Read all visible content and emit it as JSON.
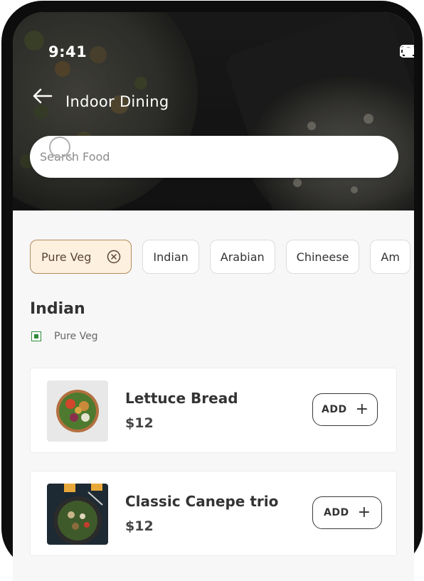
{
  "status_bar": {
    "time": "9:41"
  },
  "header": {
    "title": "Indoor Dining"
  },
  "search": {
    "placeholder": "Search Food",
    "value": ""
  },
  "filters": [
    {
      "label": "Pure Veg",
      "active": true
    },
    {
      "label": "Indian",
      "active": false
    },
    {
      "label": "Arabian",
      "active": false
    },
    {
      "label": "Chineese",
      "active": false
    },
    {
      "label": "Am",
      "active": false
    }
  ],
  "section": {
    "title": "Indian",
    "tag": "Pure Veg"
  },
  "items": [
    {
      "name": "Lettuce Bread",
      "price": "$12",
      "add_label": "ADD"
    },
    {
      "name": "Classic Canepe trio",
      "price": "$12",
      "add_label": "ADD"
    }
  ],
  "colors": {
    "accent": "#b38b5d",
    "chip_active_bg": "#fdf0df",
    "veg_green": "#2d8a3a"
  }
}
